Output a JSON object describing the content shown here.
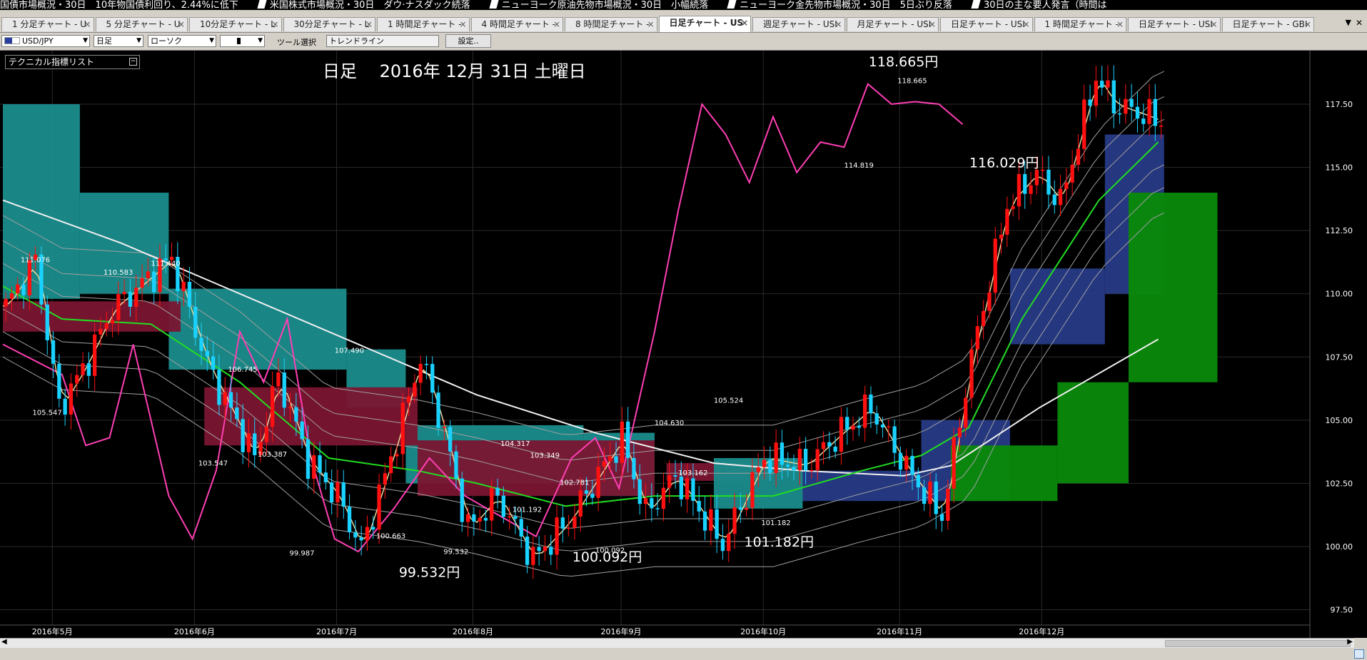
{
  "ticker": [
    "国債市場概況・30日　10年物国債利回り、2.44%に低下",
    "米国株式市場概況・30日　ダウ·ナスダック続落",
    "ニューヨーク原油先物市場概況・30日　小幅続落",
    "ニューヨーク金先物市場概況・30日　5日ぶり反落",
    "30日の主な要人発言（時間は"
  ],
  "tabs": [
    {
      "label": "1 分足チャート - U"
    },
    {
      "label": "5 分足チャート - U"
    },
    {
      "label": "10分足チャート - L"
    },
    {
      "label": "30分足チャート - L"
    },
    {
      "label": "1 時間足チャート -"
    },
    {
      "label": "4 時間足チャート -"
    },
    {
      "label": "8 時間足チャート -"
    },
    {
      "label": "日足チャート - US",
      "active": true
    },
    {
      "label": "週足チャート - USI"
    },
    {
      "label": "月足チャート - USI"
    },
    {
      "label": "日足チャート - USI"
    },
    {
      "label": "1 時間足チャート -"
    },
    {
      "label": "日足チャート - USI"
    },
    {
      "label": "日足チャート - GBI"
    }
  ],
  "toolbar": {
    "symbol": "USD/JPY",
    "period": "日足",
    "chart_style": "ローソク",
    "tool_select_label": "ツール選択",
    "tool_value": "トレンドライン",
    "settings_label": "設定..",
    "indicator_list_label": "テクニカル指標リスト"
  },
  "chart_header": "日足　 2016年 12月 31日 土曜日",
  "colors": {
    "background": "#000000",
    "candle_up": "#ff1010",
    "candle_down": "#1ad2ff",
    "ichimoku_cloud_bull": "#0a8a0a",
    "ichimoku_cloud_bear": "#7a1530",
    "cloud_teal": "#1a8c8c",
    "cloud_navy": "#263a86",
    "chikou_line": "#ff3fb4",
    "ma_white": "#f0f0f0",
    "ma_green": "#22dd22",
    "ma_tan": "#e8d89a",
    "bollinger": "#a0a0a0",
    "grid": "#2a2a2a"
  },
  "chart_data": {
    "type": "candlestick",
    "instrument": "USD/JPY",
    "timeframe": "日足",
    "ylim": [
      97.5,
      118.75
    ],
    "y_ticks": [
      "117.50",
      "115.00",
      "112.50",
      "110.00",
      "107.50",
      "105.00",
      "102.50",
      "100.00",
      "97.50"
    ],
    "x_labels": [
      "2016年5月",
      "2016年6月",
      "2016年7月",
      "2016年8月",
      "2016年9月",
      "2016年10月",
      "2016年11月",
      "2016年12月"
    ],
    "x_label_bar": [
      4,
      28,
      52,
      75,
      100,
      124,
      147,
      171
    ],
    "n_bars": 196,
    "price_path": [
      [
        0,
        109.5
      ],
      [
        5,
        111.3
      ],
      [
        9,
        105.5
      ],
      [
        13,
        107.0
      ],
      [
        18,
        109.4
      ],
      [
        24,
        110.6
      ],
      [
        28,
        111.4
      ],
      [
        34,
        107.2
      ],
      [
        42,
        103.5
      ],
      [
        46,
        106.7
      ],
      [
        51,
        103.4
      ],
      [
        56,
        102.0
      ],
      [
        60,
        99.9
      ],
      [
        65,
        103.5
      ],
      [
        70,
        107.5
      ],
      [
        74,
        104.5
      ],
      [
        78,
        100.7
      ],
      [
        83,
        102.0
      ],
      [
        89,
        99.5
      ],
      [
        95,
        101.0
      ],
      [
        104,
        104.3
      ],
      [
        108,
        101.3
      ],
      [
        113,
        102.8
      ],
      [
        116,
        101.8
      ],
      [
        121,
        100.1
      ],
      [
        128,
        103.5
      ],
      [
        135,
        103.2
      ],
      [
        141,
        104.5
      ],
      [
        146,
        105.5
      ],
      [
        152,
        103.1
      ],
      [
        158,
        101.2
      ],
      [
        163,
        107.5
      ],
      [
        169,
        113.5
      ],
      [
        174,
        114.8
      ],
      [
        178,
        113.6
      ],
      [
        184,
        118.6
      ],
      [
        187,
        117.5
      ],
      [
        193,
        117.0
      ],
      [
        195,
        116.8
      ]
    ],
    "ma_white": [
      [
        0,
        113.7
      ],
      [
        20,
        112.0
      ],
      [
        35,
        110.5
      ],
      [
        60,
        108.0
      ],
      [
        80,
        106.0
      ],
      [
        100,
        104.5
      ],
      [
        120,
        103.3
      ],
      [
        135,
        103.0
      ],
      [
        152,
        102.8
      ],
      [
        160,
        103.2
      ],
      [
        175,
        105.5
      ],
      [
        195,
        108.2
      ]
    ],
    "ma_green": [
      [
        0,
        110.3
      ],
      [
        10,
        109.0
      ],
      [
        25,
        108.8
      ],
      [
        40,
        106.5
      ],
      [
        55,
        103.5
      ],
      [
        70,
        103.0
      ],
      [
        80,
        102.5
      ],
      [
        95,
        101.6
      ],
      [
        110,
        102.0
      ],
      [
        130,
        102.0
      ],
      [
        145,
        103.0
      ],
      [
        155,
        103.6
      ],
      [
        163,
        104.7
      ],
      [
        172,
        109.0
      ],
      [
        185,
        113.7
      ],
      [
        195,
        116.0
      ]
    ],
    "chikou": [
      [
        0,
        108.0
      ],
      [
        10,
        106.8
      ],
      [
        14,
        104.0
      ],
      [
        18,
        104.3
      ],
      [
        22,
        108.0
      ],
      [
        28,
        102.0
      ],
      [
        32,
        100.3
      ],
      [
        36,
        103.0
      ],
      [
        40,
        108.5
      ],
      [
        44,
        106.5
      ],
      [
        48,
        109.0
      ],
      [
        52,
        103.5
      ],
      [
        56,
        100.3
      ],
      [
        60,
        99.8
      ],
      [
        66,
        101.5
      ],
      [
        72,
        103.5
      ],
      [
        78,
        102.0
      ],
      [
        84,
        101.2
      ],
      [
        90,
        100.4
      ],
      [
        96,
        103.5
      ],
      [
        100,
        104.3
      ],
      [
        104,
        102.3
      ],
      [
        110,
        108.5
      ],
      [
        114,
        113.3
      ],
      [
        118,
        117.5
      ],
      [
        122,
        116.3
      ],
      [
        126,
        114.4
      ],
      [
        130,
        117.0
      ],
      [
        134,
        114.8
      ],
      [
        138,
        116.0
      ],
      [
        142,
        115.8
      ],
      [
        146,
        118.3
      ],
      [
        150,
        117.5
      ],
      [
        154,
        117.6
      ],
      [
        158,
        117.5
      ],
      [
        162,
        116.7
      ]
    ],
    "cloud": [
      {
        "from": 0,
        "to": 13,
        "top": 117.5,
        "bottom": 109.8,
        "color": "teal"
      },
      {
        "from": 13,
        "to": 28,
        "top": 114.0,
        "bottom": 110.0,
        "color": "teal"
      },
      {
        "from": 28,
        "to": 58,
        "top": 110.2,
        "bottom": 107.0,
        "color": "teal"
      },
      {
        "from": 58,
        "to": 68,
        "top": 107.8,
        "bottom": 105.5,
        "color": "teal"
      },
      {
        "from": 68,
        "to": 98,
        "top": 104.8,
        "bottom": 102.5,
        "color": "teal"
      },
      {
        "from": 98,
        "to": 110,
        "top": 104.5,
        "bottom": 102.0,
        "color": "teal"
      },
      {
        "from": 0,
        "to": 30,
        "top": 109.7,
        "bottom": 108.5,
        "color": "maroon"
      },
      {
        "from": 34,
        "to": 70,
        "top": 106.3,
        "bottom": 104.0,
        "color": "maroon"
      },
      {
        "from": 70,
        "to": 110,
        "top": 104.2,
        "bottom": 102.0,
        "color": "maroon"
      },
      {
        "from": 112,
        "to": 130,
        "top": 103.3,
        "bottom": 102.6,
        "color": "maroon"
      },
      {
        "from": 120,
        "to": 135,
        "top": 103.5,
        "bottom": 101.5,
        "color": "teal"
      },
      {
        "from": 135,
        "to": 155,
        "top": 103.0,
        "bottom": 101.8,
        "color": "navy"
      },
      {
        "from": 155,
        "to": 170,
        "top": 105.0,
        "bottom": 101.8,
        "color": "navy"
      },
      {
        "from": 170,
        "to": 186,
        "top": 111.0,
        "bottom": 108.0,
        "color": "navy"
      },
      {
        "from": 186,
        "to": 196,
        "top": 116.3,
        "bottom": 110.0,
        "color": "navy"
      },
      {
        "from": 160,
        "to": 178,
        "top": 104.0,
        "bottom": 101.8,
        "color": "green"
      },
      {
        "from": 178,
        "to": 190,
        "top": 106.5,
        "bottom": 102.5,
        "color": "green"
      },
      {
        "from": 190,
        "to": 205,
        "top": 114.0,
        "bottom": 106.5,
        "color": "green"
      }
    ],
    "price_labels": [
      {
        "bar": 5,
        "value": "111.076"
      },
      {
        "bar": 27,
        "value": "111.440"
      },
      {
        "bar": 19,
        "value": "110.583"
      },
      {
        "bar": 7,
        "value": "105.547"
      },
      {
        "bar": 40,
        "value": "106.745"
      },
      {
        "bar": 35,
        "value": "103.547"
      },
      {
        "bar": 45,
        "value": "103.387"
      },
      {
        "bar": 50,
        "value": "99.987"
      },
      {
        "bar": 58,
        "value": "107.490"
      },
      {
        "bar": 65,
        "value": "100.663"
      },
      {
        "bar": 76,
        "value": "99.532"
      },
      {
        "bar": 86,
        "value": "104.317"
      },
      {
        "bar": 91,
        "value": "103.349"
      },
      {
        "bar": 96,
        "value": "102.781"
      },
      {
        "bar": 88,
        "value": "101.192"
      },
      {
        "bar": 102,
        "value": "100.092"
      },
      {
        "bar": 112,
        "value": "104.630"
      },
      {
        "bar": 116,
        "value": "103.162"
      },
      {
        "bar": 122,
        "value": "105.524"
      },
      {
        "bar": 130,
        "value": "101.182"
      },
      {
        "bar": 144,
        "value": "114.819"
      },
      {
        "bar": 153,
        "value": "118.665"
      }
    ],
    "big_labels": [
      {
        "text": "118.665円",
        "bar": 152,
        "value": 119.0
      },
      {
        "text": "116.029円",
        "bar": 169,
        "value": 115.0
      },
      {
        "text": "101.182円",
        "bar": 131,
        "value": 100.0
      },
      {
        "text": "100.092円",
        "bar": 102,
        "value": 99.4
      },
      {
        "text": "99.532円",
        "bar": 72,
        "value": 98.8
      }
    ]
  }
}
